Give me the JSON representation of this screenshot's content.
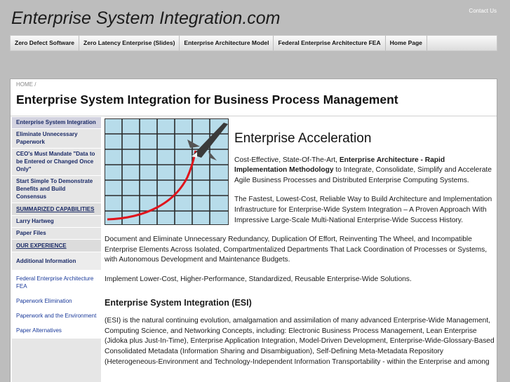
{
  "header": {
    "site_title": "Enterprise System Integration.com",
    "contact_label": "Contact Us"
  },
  "topnav": {
    "items": [
      "Zero Defect Software",
      "Zero Latency Enterprise (Slides)",
      "Enterprise Architecture Model",
      "Federal Enterprise Architecture FEA",
      "Home Page"
    ]
  },
  "breadcrumb": {
    "home": "HOME",
    "separator": "/"
  },
  "page": {
    "title": "Enterprise System Integration for Business Process Management"
  },
  "sidebar": {
    "items": [
      "Enterprise System Integration",
      "Eliminate Unnecessary Paperwork",
      "CEO's Must Mandate \"Data to be Entered or Changed Once Only\"",
      "Start Simple To Demonstrate Benefits and Build Consensus"
    ],
    "heading_capabilities": "SUMMARIZED CAPABILITIES",
    "items2": [
      "Larry Hartweg"
    ],
    "items3": [
      "Paper Files"
    ],
    "heading_experience": "OUR EXPERIENCE",
    "additional_title": "Additional Information",
    "sub_links": [
      "Federal Enterprise Architecture FEA",
      "Paperwork Elimination",
      "Paperwork and the Environment",
      "Paper Alternatives"
    ]
  },
  "main": {
    "hero_heading": "Enterprise Acceleration",
    "intro_prefix": "Cost-Effective, State-Of-The-Art,",
    "intro_bold": "Enterprise Architecture - Rapid Implementation Methodology",
    "intro_suffix": "to Integrate, Consolidate, Simplify and Accelerate Agile Business Processes and Distributed Enterprise Computing Systems.",
    "p2": "The Fastest, Lowest-Cost, Reliable Way to Build Architecture and Implementation Infrastructure for Enterprise-Wide System Integration – A Proven Approach With Impressive Large-Scale Multi-National Enterprise-Wide Success History.",
    "p3": "Document and Eliminate Unnecessary Redundancy, Duplication Of Effort, Reinventing The Wheel, and Incompatible Enterprise Elements Across Isolated, Compartmentalized Departments That Lack Coordination of Processes or Systems, with Autonomous Development and Maintenance Budgets.",
    "p4": "Implement Lower-Cost, Higher-Performance, Standardized, Reusable Enterprise-Wide Solutions.",
    "section_heading": "Enterprise System Integration (ESI)",
    "p5": "(ESI) is the natural continuing evolution, amalgamation and assimilation of many advanced Enterprise-Wide Management, Computing Science, and Networking Concepts, including: Electronic Business Process Management, Lean Enterprise (Jidoka plus Just-In-Time), Enterprise Application Integration, Model-Driven Development, Enterprise-Wide-Glossary-Based Consolidated Metadata (Information Sharing and Disambiguation), Self-Defining Meta-Metadata Repository (Heterogeneous-Environment and Technology-Independent Information Transportability - within the Enterprise and among"
  },
  "colors": {
    "page_bg": "#bdbdbd",
    "sidebar_bg": "#e6e6e6",
    "link": "#1a2a66",
    "chart_curve": "#e0141c",
    "grid_bg": "#b7dcea"
  }
}
